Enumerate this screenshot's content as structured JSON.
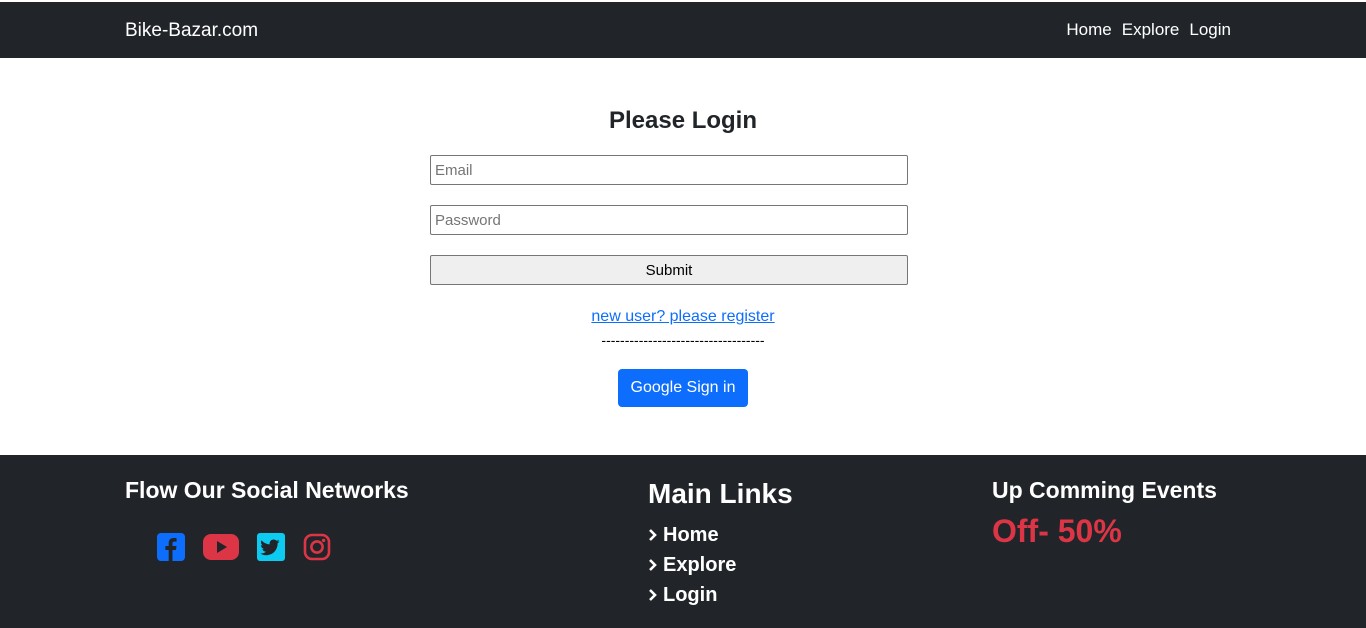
{
  "navbar": {
    "brand": "Bike-Bazar.com",
    "links": [
      {
        "label": "Home"
      },
      {
        "label": "Explore"
      },
      {
        "label": "Login"
      }
    ]
  },
  "login": {
    "title": "Please Login",
    "email_placeholder": "Email",
    "password_placeholder": "Password",
    "submit_label": "Submit",
    "register_link": "new user? please register",
    "divider": "-----------------------------------",
    "google_button": "Google Sign in"
  },
  "footer": {
    "social_title": "Flow Our Social Networks",
    "social_icons": [
      {
        "icon": "facebook-icon",
        "color": "#0d6efd"
      },
      {
        "icon": "youtube-icon",
        "color": "#dc3545"
      },
      {
        "icon": "twitter-icon",
        "color": "#0dcaf0"
      },
      {
        "icon": "instagram-icon",
        "color": "#dc3545"
      }
    ],
    "links_title": "Main Links",
    "links": [
      {
        "label": "Home"
      },
      {
        "label": "Explore"
      },
      {
        "label": "Login"
      }
    ],
    "events_title": "Up Comming Events",
    "offer": "Off- 50%"
  },
  "colors": {
    "dark": "#212529",
    "primary": "#0d6efd",
    "danger": "#dc3545",
    "info": "#0dcaf0"
  }
}
